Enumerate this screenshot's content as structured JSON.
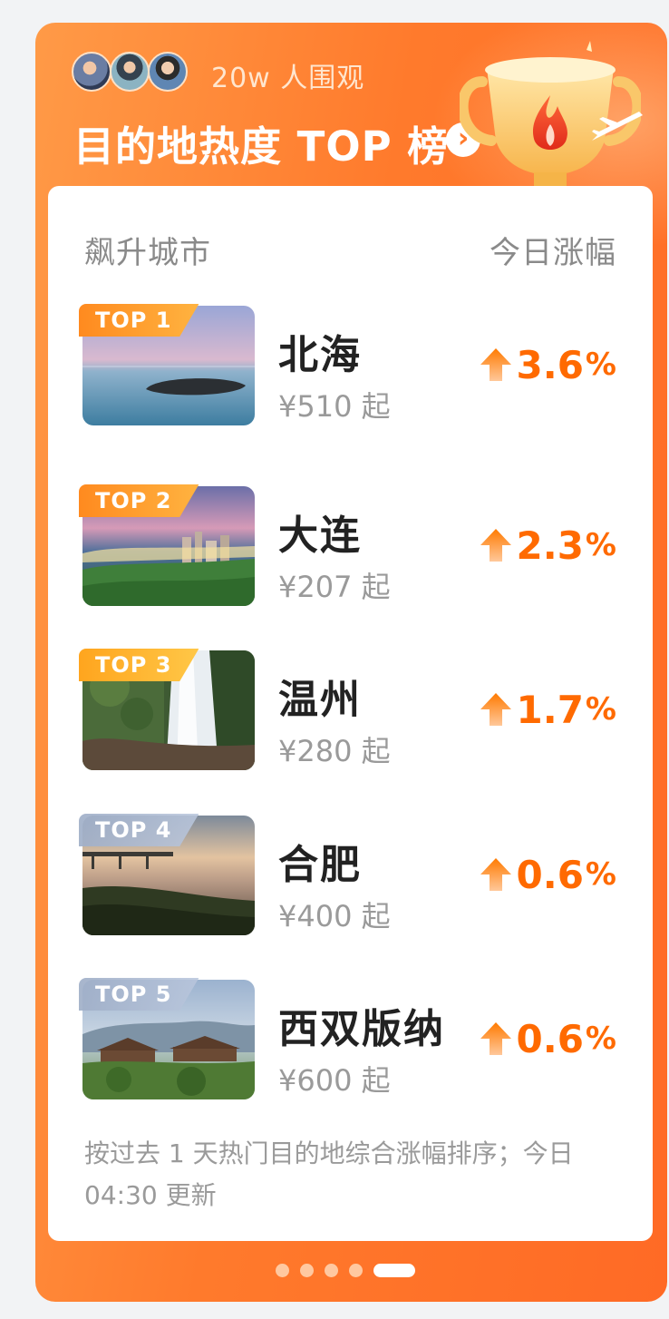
{
  "header": {
    "watchers_text": "20w 人围观",
    "title": "目的地热度 TOP 榜",
    "more_arrow": "›"
  },
  "table": {
    "col_left": "飙升城市",
    "col_right": "今日涨幅"
  },
  "rows": [
    {
      "rank": "TOP 1",
      "city": "北海",
      "price": "¥510 起",
      "growth": "3.6",
      "unit": "%"
    },
    {
      "rank": "TOP 2",
      "city": "大连",
      "price": "¥207 起",
      "growth": "2.3",
      "unit": "%"
    },
    {
      "rank": "TOP 3",
      "city": "温州",
      "price": "¥280 起",
      "growth": "1.7",
      "unit": "%"
    },
    {
      "rank": "TOP 4",
      "city": "合肥",
      "price": "¥400 起",
      "growth": "0.6",
      "unit": "%"
    },
    {
      "rank": "TOP 5",
      "city": "西双版纳",
      "price": "¥600 起",
      "growth": "0.6",
      "unit": "%"
    }
  ],
  "footnote": "按过去 1 天热门目的地综合涨幅排序；今日 04:30 更新",
  "pagination": {
    "total": 5,
    "active": 5
  },
  "colors": {
    "accent": "#ff6a00",
    "card_bg": "#ff7a2c"
  }
}
